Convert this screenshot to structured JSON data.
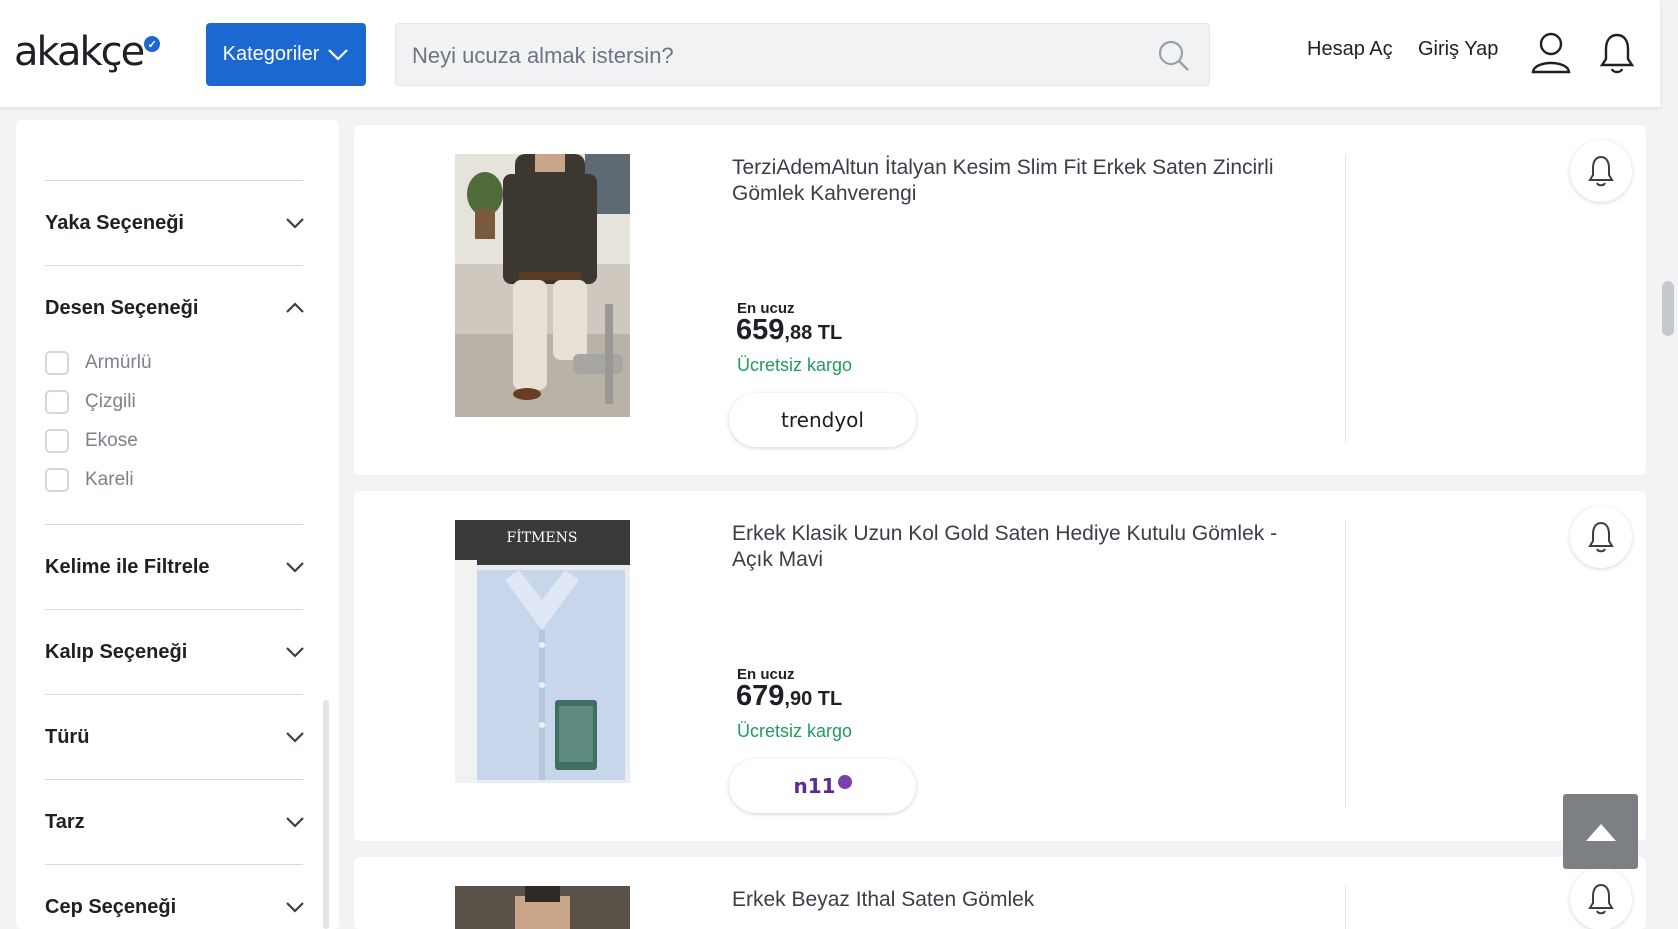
{
  "header": {
    "logo_text": "akakçe",
    "logo_badge": "✓",
    "categories_label": "Kategoriler",
    "search_placeholder": "Neyi ucuza almak istersin?",
    "signup_label": "Hesap Aç",
    "login_label": "Giriş Yap"
  },
  "sidebar": {
    "filters": [
      {
        "label": "Yaka Seçeneği",
        "expanded": false
      },
      {
        "label": "Desen Seçeneği",
        "expanded": true,
        "options": [
          "Armürlü",
          "Çizgili",
          "Ekose",
          "Kareli"
        ]
      },
      {
        "label": "Kelime ile Filtrele",
        "expanded": false
      },
      {
        "label": "Kalıp Seçeneği",
        "expanded": false
      },
      {
        "label": "Türü",
        "expanded": false
      },
      {
        "label": "Tarz",
        "expanded": false
      },
      {
        "label": "Cep Seçeneği",
        "expanded": false
      }
    ]
  },
  "products": [
    {
      "title": "TerziAdemAltun İtalyan Kesim Slim Fit Erkek Saten Zincirli Gömlek Kahverengi",
      "cheapest_label": "En ucuz",
      "price_main": "659",
      "price_fraction": ",88 TL",
      "shipping": "Ücretsiz kargo",
      "merchant": "trendyol"
    },
    {
      "title": "Erkek Klasik Uzun Kol Gold Saten Hediye Kutulu Gömlek - Açık Mavi",
      "cheapest_label": "En ucuz",
      "price_main": "679",
      "price_fraction": ",90 TL",
      "shipping": "Ücretsiz kargo",
      "merchant": "n11",
      "image_text": "FİTMENS"
    },
    {
      "title": "Erkek Beyaz Ithal Saten Gömlek"
    }
  ],
  "colors": {
    "brand_blue": "#1c68d3",
    "shipping_green": "#1f9c5e",
    "merchant_n11": "#5c2d91"
  }
}
